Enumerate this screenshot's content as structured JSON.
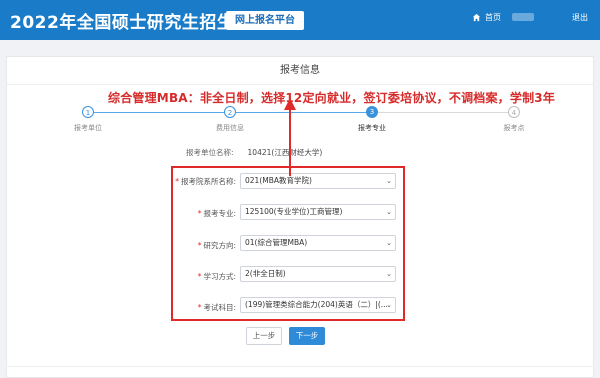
{
  "header": {
    "title": "2022年全国硕士研究生招生考试",
    "platform": "网上报名平台",
    "home": "首页",
    "exit": "退出",
    "bg_color": "#1a7cc8"
  },
  "panel": {
    "title": "报考信息"
  },
  "annotation": {
    "text": "综合管理MBA：非全日制，选择12定向就业，签订委培协议，不调档案，学制3年",
    "color": "#d62b2b"
  },
  "steps": [
    {
      "num": "1",
      "label": "报考单位",
      "state": "done"
    },
    {
      "num": "2",
      "label": "费用信息",
      "state": "done"
    },
    {
      "num": "3",
      "label": "报考专业",
      "state": "active"
    },
    {
      "num": "4",
      "label": "报考点",
      "state": "todo"
    }
  ],
  "unit": {
    "label": "报考单位名称:",
    "value": "10421(江西财经大学)"
  },
  "form": {
    "fields": [
      {
        "label": "报考院系所名称:",
        "value": "021(MBA教育学院)"
      },
      {
        "label": "报考专业:",
        "value": "125100(专业学位)工商管理)"
      },
      {
        "label": "研究方向:",
        "value": "01(综合管理MBA)"
      },
      {
        "label": "学习方式:",
        "value": "2(非全日制)"
      },
      {
        "label": "考试科目:",
        "value": "(199)管理类综合能力(204)英语（二）|(..."
      }
    ],
    "required_mark": "*",
    "caret": "⌄"
  },
  "buttons": {
    "prev": "上一步",
    "next": "下一步"
  }
}
